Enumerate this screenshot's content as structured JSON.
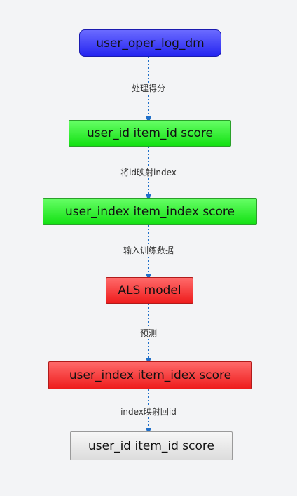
{
  "diagram": {
    "nodes": [
      {
        "id": "n1",
        "label": "user_oper_log_dm"
      },
      {
        "id": "n2",
        "label": "user_id item_id score"
      },
      {
        "id": "n3",
        "label": "user_index item_index score"
      },
      {
        "id": "n4",
        "label": "ALS model"
      },
      {
        "id": "n5",
        "label": "user_index item_idex score"
      },
      {
        "id": "n6",
        "label": "user_id item_id score"
      }
    ],
    "edges": [
      {
        "from": "n1",
        "to": "n2",
        "label": "处理得分"
      },
      {
        "from": "n2",
        "to": "n3",
        "label": "将id映射index"
      },
      {
        "from": "n3",
        "to": "n4",
        "label": "输入训练数据"
      },
      {
        "from": "n4",
        "to": "n5",
        "label": "预测"
      },
      {
        "from": "n5",
        "to": "n6",
        "label": "index映射回id"
      }
    ],
    "colors": {
      "node_blue": "#3b3bff",
      "node_green": "#22ee22",
      "node_red": "#f23030",
      "node_gray": "#e6e6e6",
      "connector": "#1f6fc9"
    }
  }
}
